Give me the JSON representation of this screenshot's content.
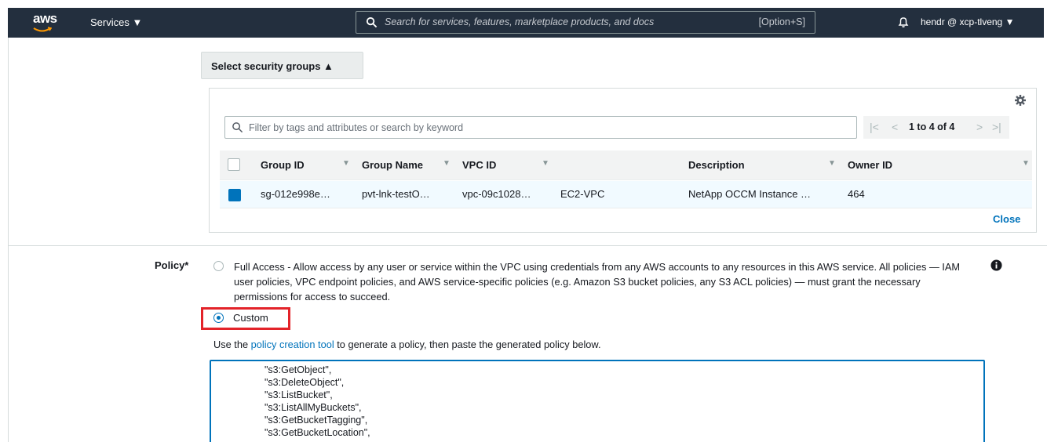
{
  "nav": {
    "logo": "aws",
    "services_label": "Services ▼",
    "search_placeholder": "Search for services, features, marketplace products, and docs",
    "search_shortcut": "[Option+S]",
    "user_label": "hendr @ xcp-tlveng ▼"
  },
  "security_groups": {
    "toggle_label": "Select security groups ▲",
    "filter_placeholder": "Filter by tags and attributes or search by keyword",
    "pagination": "1 to 4 of 4",
    "columns": [
      "Group ID",
      "Group Name",
      "VPC ID",
      "Description",
      "Owner ID"
    ],
    "rows": [
      {
        "group_id": "sg-012e998e…",
        "group_name": "pvt-lnk-testO…",
        "vpc_id": "vpc-09c1028…",
        "vpc_name": "EC2-VPC",
        "description": "NetApp OCCM Instance …",
        "owner_id": "464"
      }
    ],
    "close_label": "Close"
  },
  "policy": {
    "label": "Policy*",
    "full_access_text": "Full Access - Allow access by any user or service within the VPC using credentials from any AWS accounts to any resources in this AWS service. All policies — IAM user policies, VPC endpoint policies, and AWS service-specific policies (e.g. Amazon S3 bucket policies, any S3 ACL policies) — must grant the necessary permissions for access to succeed.",
    "custom_label": "Custom",
    "help_prefix": "Use the",
    "help_link": "policy creation tool",
    "help_suffix": "to generate a policy, then paste the generated policy below.",
    "code_lines": [
      "\"s3:GetObject\",",
      "\"s3:DeleteObject\",",
      "\"s3:ListBucket\",",
      "\"s3:ListAllMyBuckets\",",
      "\"s3:GetBucketTagging\",",
      "\"s3:GetBucketLocation\","
    ]
  }
}
